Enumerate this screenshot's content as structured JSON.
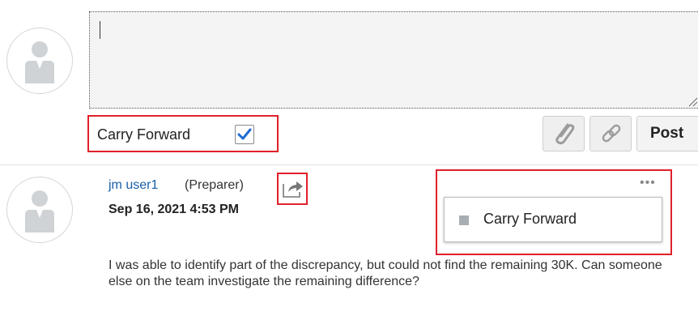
{
  "composer": {
    "value": "",
    "carry_forward_label": "Carry Forward",
    "carry_forward_checked": true,
    "post_label": "Post",
    "attach_icon": "paperclip-icon",
    "link_icon": "link-icon"
  },
  "comment": {
    "author": "jm user1",
    "role": "(Preparer)",
    "timestamp": "Sep 16, 2021 4:53 PM",
    "body": "I was able to identify part of the discrepancy, but could not find the remaining 30K. Can someone else on the team investigate the remaining difference?",
    "share_icon": "share-forward-icon",
    "more_label": "•••",
    "menu": {
      "items": [
        {
          "label": "Carry Forward"
        }
      ]
    }
  },
  "colors": {
    "highlight": "#e0202a",
    "link": "#1a5fa8",
    "check": "#1f6bd0"
  }
}
